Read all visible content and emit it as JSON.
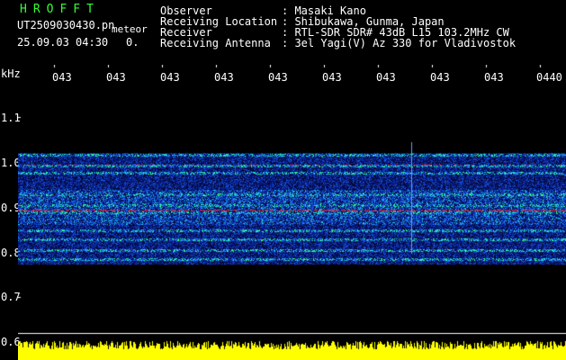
{
  "brand": "HROFFT",
  "file_name": "UT2509030430.pn",
  "file_suffix": "meteor",
  "timestamp": "25.09.03 04:30",
  "timestamp_extra": "0.",
  "info_labels": [
    "Observer",
    "Receiving Location",
    "Receiver",
    "Receiving Antenna"
  ],
  "info_values": [
    ": Masaki Kano",
    ": Shibukawa, Gunma, Japan",
    ": RTL-SDR SDR# 43dB L15 103.2MHz CW",
    ": 3el Yagi(V) Az 330 for Vladivostok"
  ],
  "time_ticks": [
    "043",
    "043",
    "043",
    "043",
    "043",
    "043",
    "043",
    "043",
    "043",
    "0440"
  ],
  "freq_unit": "kHz",
  "freq_ticks": [
    "1.1",
    "1.0",
    "0.9",
    "0.8",
    "0.7",
    "0.6"
  ],
  "colors": {
    "brand": "#33ff33",
    "signal_line": "#ff2020",
    "amplitude": "#ffff00",
    "noise_blue": "#1030c0"
  }
}
